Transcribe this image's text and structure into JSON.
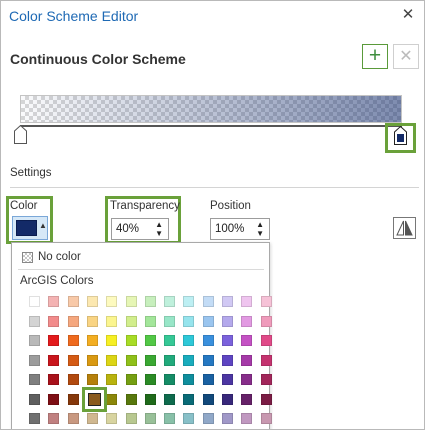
{
  "window": {
    "title": "Color Scheme Editor",
    "close_icon": "close-icon"
  },
  "scheme": {
    "heading": "Continuous Color Scheme",
    "add_icon": "plus-icon",
    "remove_icon": "x-icon",
    "add_glyph": "+",
    "remove_glyph": "✕"
  },
  "settings": {
    "label": "Settings",
    "color_label": "Color",
    "transparency_label": "Transparency",
    "transparency_value": "40%",
    "position_label": "Position",
    "position_value": "100%",
    "current_color": "#132a68",
    "flip_icon": "flip-icon"
  },
  "colors": {
    "highlight": "#6aa13a",
    "title_blue": "#1e69b4"
  },
  "dropdown": {
    "no_color_label": "No color",
    "palette_title": "ArcGIS Colors",
    "selected_color": "#8a5a1c",
    "palette": [
      [
        "#ffffff",
        "#f4b3b3",
        "#f8c9a8",
        "#fce8b0",
        "#fdfabf",
        "#e6f6b5",
        "#c7efbd",
        "#bff0dc",
        "#bdeff3",
        "#c3dcf6",
        "#d1c9f4",
        "#efc5ef",
        "#f6c2d7"
      ],
      [
        "#d4d4d4",
        "#f28b8b",
        "#f5a77e",
        "#f9d483",
        "#fbf58f",
        "#d2ee8c",
        "#a3e69a",
        "#98e6c8",
        "#96e4ed",
        "#9ac5ef",
        "#b4a9ec",
        "#e29ae2",
        "#ef9bbb"
      ],
      [
        "#b9b9b9",
        "#e31a1c",
        "#ef6a1e",
        "#f3ae22",
        "#f6ef24",
        "#a8dc26",
        "#52c846",
        "#36c896",
        "#2ec8d8",
        "#3a90dd",
        "#7b62dc",
        "#c452c4",
        "#e04a88"
      ],
      [
        "#9c9c9c",
        "#c9151c",
        "#d45a14",
        "#d99912",
        "#dcd515",
        "#8fc01a",
        "#3aa832",
        "#21aa7c",
        "#1aacbd",
        "#2578c2",
        "#5e45c2",
        "#a53aa8",
        "#c4336f"
      ],
      [
        "#7f7f7f",
        "#a8111a",
        "#b1490e",
        "#b6800b",
        "#b9b30e",
        "#759f12",
        "#2b8b25",
        "#158c66",
        "#0f8e9d",
        "#1a61a2",
        "#4c36a2",
        "#872d8a",
        "#a2265a"
      ],
      [
        "#5f5f5f",
        "#7e0e14",
        "#85370a",
        "#8a5a1c",
        "#8b8709",
        "#58780c",
        "#1f6a1a",
        "#0e6b4d",
        "#0a6b77",
        "#12497b",
        "#38287b",
        "#662168",
        "#7b1c44"
      ],
      [
        "#707070",
        "#c08080",
        "#c89880",
        "#d0b890",
        "#d8d4a0",
        "#b8c890",
        "#98c098",
        "#88c0a8",
        "#88c0c8",
        "#90a8c8",
        "#a098c8",
        "#c098c0",
        "#c898b0"
      ]
    ]
  }
}
